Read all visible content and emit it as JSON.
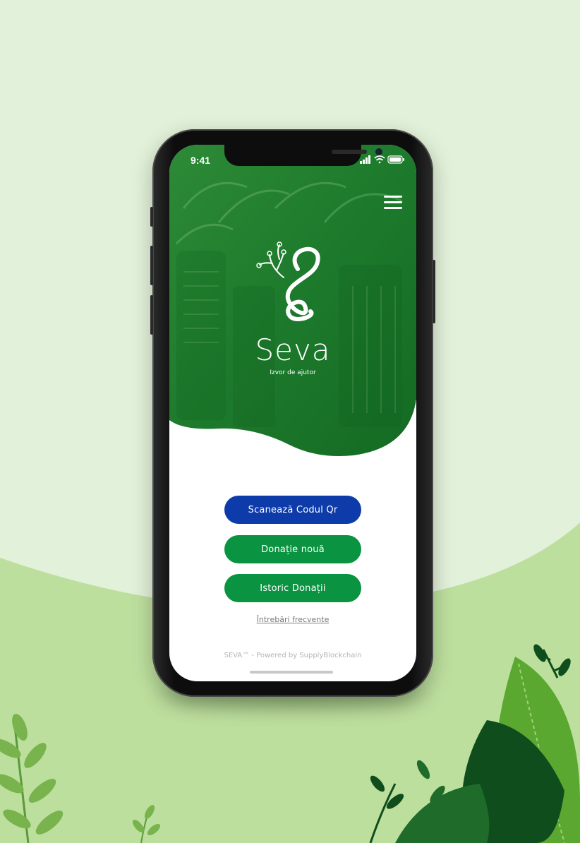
{
  "status_bar": {
    "time": "9:41",
    "icons": [
      "signal-icon",
      "wifi-icon",
      "battery-icon"
    ]
  },
  "header": {
    "menu_icon": "hamburger-menu-icon"
  },
  "brand": {
    "logo_icon": "seva-sprout-logo-icon",
    "name": "Seva",
    "tagline": "Izvor de ajutor"
  },
  "actions": {
    "scan_qr": "Scanează Codul Qr",
    "new_donation": "Donație nouă",
    "donation_history": "Istoric Donații"
  },
  "faq_link": "Întrebări frecvente",
  "footer": "SEVA™ - Powered by SupplyBlockchain",
  "colors": {
    "primary_blue": "#0d3ba9",
    "primary_green": "#0a9340",
    "hero_green": "#1b7a2b",
    "page_background": "#e2f1d9",
    "hill_green": "#bddf9e"
  }
}
